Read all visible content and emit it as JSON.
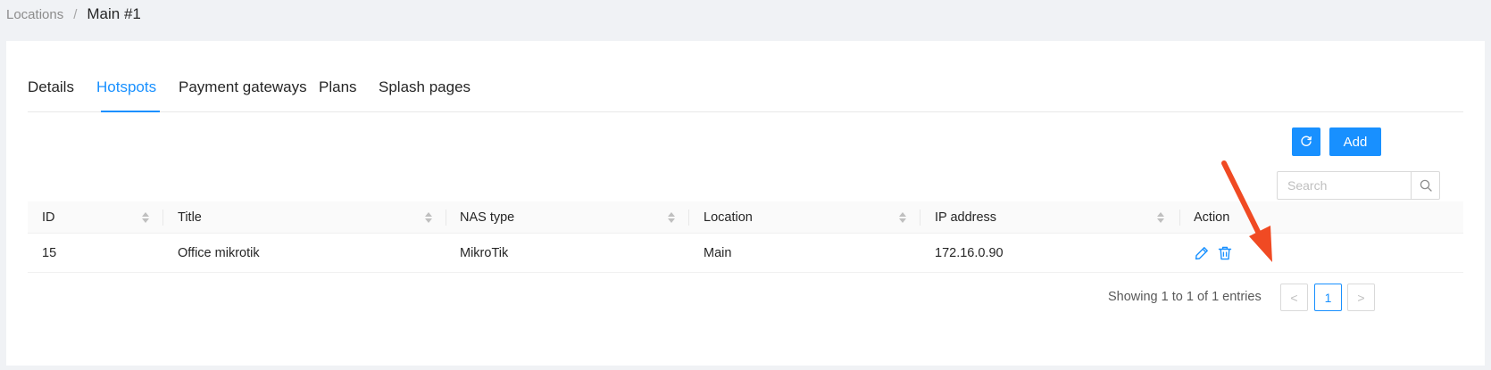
{
  "breadcrumb": {
    "parent": "Locations",
    "separator": "/",
    "current": "Main #1"
  },
  "tabs": [
    {
      "label": "Details",
      "active": false
    },
    {
      "label": "Hotspots",
      "active": true
    },
    {
      "label": "Payment gateways",
      "active": false
    },
    {
      "label": "Plans",
      "active": false
    },
    {
      "label": "Splash pages",
      "active": false
    }
  ],
  "toolbar": {
    "refresh_icon": "reload-icon",
    "add_label": "Add"
  },
  "search": {
    "placeholder": "Search",
    "value": ""
  },
  "table": {
    "columns": [
      {
        "label": "ID",
        "sortable": true
      },
      {
        "label": "Title",
        "sortable": true
      },
      {
        "label": "NAS type",
        "sortable": true
      },
      {
        "label": "Location",
        "sortable": true
      },
      {
        "label": "IP address",
        "sortable": true
      },
      {
        "label": "Action",
        "sortable": false
      }
    ],
    "rows": [
      {
        "id": "15",
        "title": "Office mikrotik",
        "nas_type": "MikroTik",
        "location": "Main",
        "ip": "172.16.0.90",
        "actions": [
          "edit-icon",
          "delete-icon"
        ]
      }
    ]
  },
  "pagination": {
    "summary": "Showing 1 to 1 of 1 entries",
    "prev": "<",
    "current": "1",
    "next": ">"
  },
  "colors": {
    "accent": "#1890ff",
    "annotation_arrow": "#f04a23"
  }
}
